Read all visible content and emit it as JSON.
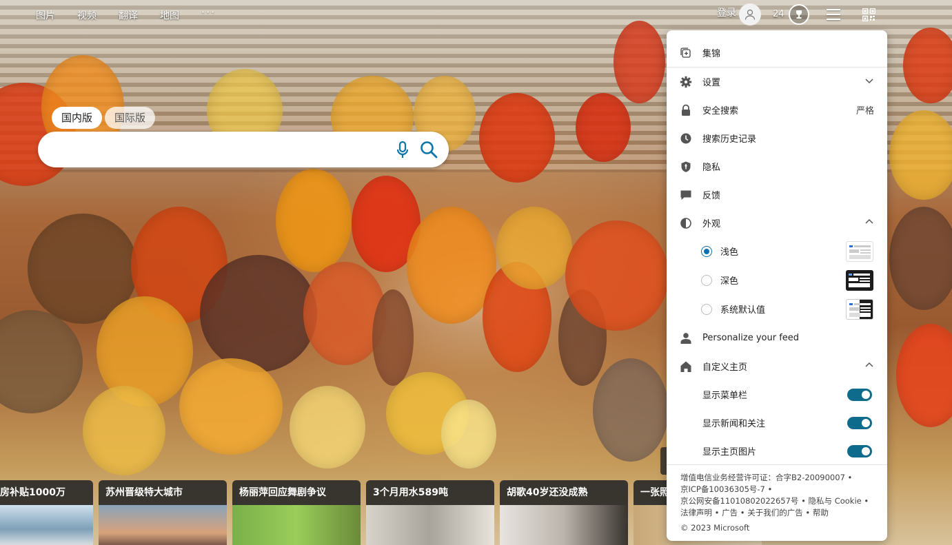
{
  "nav": {
    "links": [
      "图片",
      "视频",
      "翻译",
      "地图"
    ],
    "more": "···",
    "login": "登录",
    "points": "24"
  },
  "search": {
    "tabs": [
      "国内版",
      "国际版"
    ],
    "active_tab": "国内版",
    "placeholder": "",
    "value": ""
  },
  "news": [
    {
      "title": "房补贴1000万"
    },
    {
      "title": "苏州晋级特大城市"
    },
    {
      "title": "杨丽萍回应舞剧争议"
    },
    {
      "title": "3个月用水589吨"
    },
    {
      "title": "胡歌40岁还没成熟"
    },
    {
      "title": "一张照"
    }
  ],
  "panel": {
    "collections": "集锦",
    "settings": "设置",
    "safe_search": "安全搜索",
    "safe_search_value": "严格",
    "history": "搜索历史记录",
    "privacy": "隐私",
    "feedback": "反馈",
    "appearance": "外观",
    "theme_light": "浅色",
    "theme_dark": "深色",
    "theme_system": "系统默认值",
    "personalize": "Personalize your feed",
    "customize_home": "自定义主页",
    "show_menu_bar": "显示菜单栏",
    "show_news": "显示新闻和关注",
    "show_home_image": "显示主页图片"
  },
  "footer": {
    "line1": "增值电信业务经营许可证：合字B2-20090007",
    "line2": "京ICP备10036305号-7",
    "line3": "京公网安备11010802022657号",
    "privacy_cookie": "隐私与 Cookie",
    "legal": "法律声明",
    "ads": "广告",
    "about_ads": "关于我们的广告",
    "help": "帮助",
    "copyright": "© 2023 Microsoft"
  },
  "colors": {
    "accent": "#0a6fb0",
    "toggle_on": "#0f6b8c"
  }
}
